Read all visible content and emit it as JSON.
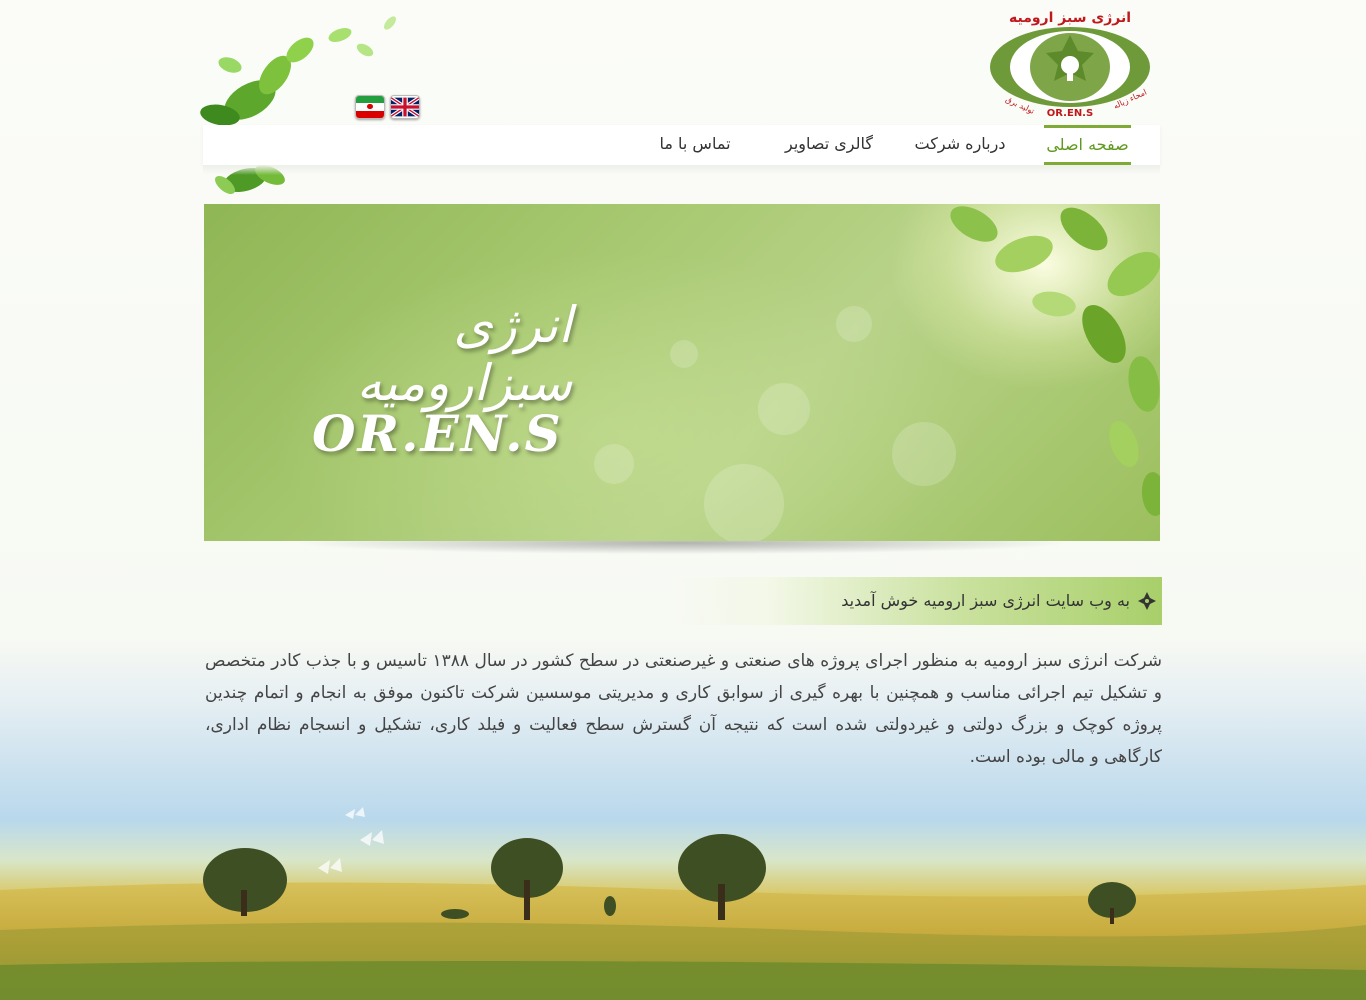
{
  "logo": {
    "title": "انرژی سبز ارومیه",
    "abbr": "OR.EN.S",
    "left_text": "تولید برق",
    "right_text": "امحاء زباله"
  },
  "flags": [
    "iran-flag-icon",
    "uk-flag-icon"
  ],
  "nav": {
    "home": "صفحه اصلی",
    "about": "درباره شرکت",
    "gallery": "گالری تصاویر",
    "contact": "تماس با ما"
  },
  "banner": {
    "title_fa": "انرژی سبزارومیه",
    "title_en": "OR.EN.S"
  },
  "welcome": "به وب سایت انرژی سبز ارومیه خوش آمدید",
  "intro": "شرکت انرژی سبز ارومیه به منظور اجرای پروژه های صنعتی و غیرصنعتی در سطح کشور در سال ۱۳۸۸ تاسیس و با جذب کادر متخصص و تشکیل تیم اجرائی مناسب و همچنین با بهره گیری از سوابق کاری و مدیریتی موسسین شرکت تاکنون موفق به انجام و اتمام چندین پروژه کوچک و بزرگ دولتی و غیردولتی شده است که نتیجه آن گسترش سطح فعالیت و فیلد کاری، تشکیل و انسجام نظام اداری، کارگاهی و مالی بوده است.",
  "colors": {
    "accent": "#7eaa35",
    "nav_active": "#5e9a1e",
    "logo_green": "#6e9a3a",
    "logo_red": "#c0191c"
  }
}
